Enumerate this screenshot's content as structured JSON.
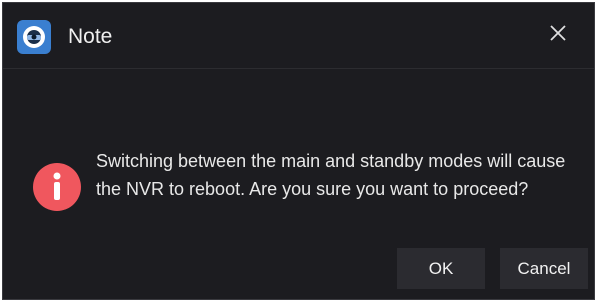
{
  "dialog": {
    "title": "Note",
    "message": "Switching between the main and standby modes will cause the NVR to reboot. Are you sure you want to proceed?",
    "ok_label": "OK",
    "cancel_label": "Cancel"
  },
  "icons": {
    "app": "camera-logo-icon",
    "close": "close-icon",
    "warning": "exclamation-circle-icon"
  },
  "colors": {
    "background": "#1c1c20",
    "app_icon": "#3a7fd0",
    "warning": "#f0575e",
    "button_bg": "#2b2b30"
  }
}
